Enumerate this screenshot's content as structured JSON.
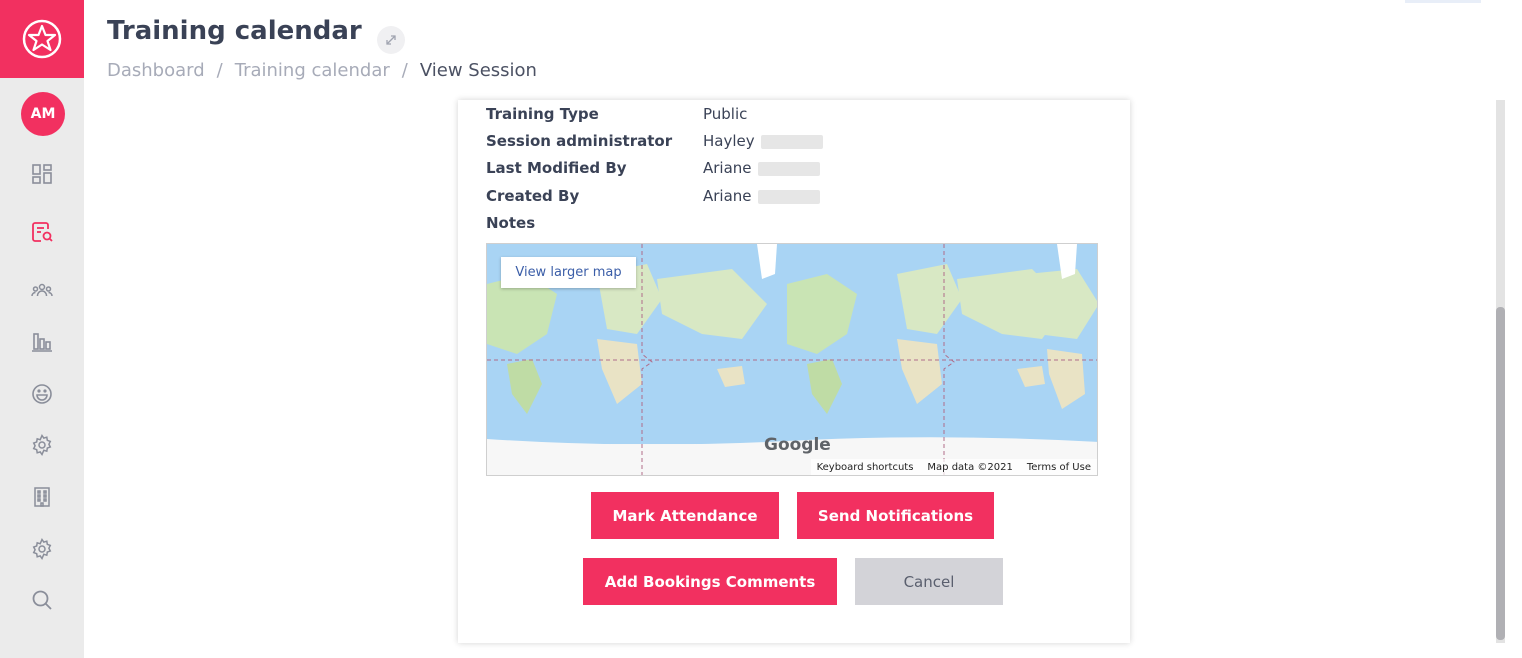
{
  "sidebar": {
    "logo_icon": "star-badge-icon",
    "avatar_initials": "AM",
    "nav_icons": [
      "dashboard-icon",
      "calendar-search-icon",
      "users-icon",
      "bar-chart-icon",
      "smiley-icon",
      "settings-icon",
      "building-icon",
      "settings-icon",
      "search-icon"
    ],
    "active_icon": "calendar-search-icon"
  },
  "header": {
    "title": "Training calendar",
    "breadcrumb": [
      "Dashboard",
      "Training calendar",
      "View Session"
    ],
    "separator": "/"
  },
  "session": {
    "fields": [
      {
        "label": "Training Type",
        "value": "Public",
        "redacted": false
      },
      {
        "label": "Session administrator",
        "value": "Hayley",
        "redacted": true
      },
      {
        "label": "Last Modified By",
        "value": "Ariane",
        "redacted": true
      },
      {
        "label": "Created By",
        "value": "Ariane",
        "redacted": true
      },
      {
        "label": "Notes",
        "value": "",
        "redacted": false
      }
    ]
  },
  "map": {
    "view_larger": "View larger map",
    "brand": "Google",
    "footer": [
      "Keyboard shortcuts",
      "Map data ©2021",
      "Terms of Use"
    ]
  },
  "actions": {
    "mark_attendance": "Mark Attendance",
    "send_notifications": "Send Notifications",
    "add_bookings_comments": "Add Bookings Comments",
    "cancel": "Cancel"
  },
  "colors": {
    "accent": "#f23060",
    "sidebar_bg": "#ebebeb",
    "text_dark": "#3a4256",
    "muted": "#a7abb8"
  }
}
